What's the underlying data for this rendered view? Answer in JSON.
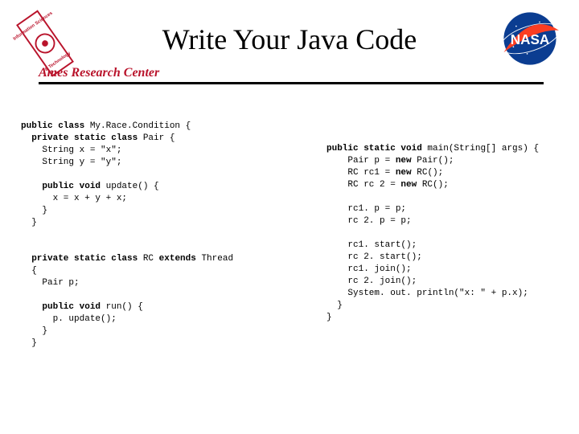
{
  "title": "Write Your Java Code",
  "subhead": "Ames Research Center",
  "badge_text_line1": "Information Sciences",
  "badge_text_line2": "& Technology",
  "logo_name": "NASA",
  "code_left_tokens": [
    {
      "t": "public class",
      "k": 1
    },
    {
      "t": " My.Race.Condition {\n"
    },
    {
      "t": "  private static class",
      "k": 1
    },
    {
      "t": " Pair {\n"
    },
    {
      "t": "    String x = \"x\";\n"
    },
    {
      "t": "    String y = \"y\";\n\n"
    },
    {
      "t": "    public void",
      "k": 1
    },
    {
      "t": " update() {\n"
    },
    {
      "t": "      x = x + y + x;\n"
    },
    {
      "t": "    }\n"
    },
    {
      "t": "  }\n\n\n"
    },
    {
      "t": "  private static class",
      "k": 1
    },
    {
      "t": " RC "
    },
    {
      "t": "extends",
      "k": 1
    },
    {
      "t": " Thread\n"
    },
    {
      "t": "  {\n"
    },
    {
      "t": "    Pair p;\n\n"
    },
    {
      "t": "    public void",
      "k": 1
    },
    {
      "t": " run() {\n"
    },
    {
      "t": "      p. update();\n"
    },
    {
      "t": "    }\n"
    },
    {
      "t": "  }\n"
    }
  ],
  "code_right_tokens": [
    {
      "t": "public static void",
      "k": 1
    },
    {
      "t": " main(String[] args) {\n"
    },
    {
      "t": "    Pair p = "
    },
    {
      "t": "new",
      "k": 1
    },
    {
      "t": " Pair();\n"
    },
    {
      "t": "    RC rc1 = "
    },
    {
      "t": "new",
      "k": 1
    },
    {
      "t": " RC();\n"
    },
    {
      "t": "    RC rc 2 = "
    },
    {
      "t": "new",
      "k": 1
    },
    {
      "t": " RC();\n\n"
    },
    {
      "t": "    rc1. p = p;\n"
    },
    {
      "t": "    rc 2. p = p;\n\n"
    },
    {
      "t": "    rc1. start();\n"
    },
    {
      "t": "    rc 2. start();\n"
    },
    {
      "t": "    rc1. join();\n"
    },
    {
      "t": "    rc 2. join();\n"
    },
    {
      "t": "    System. out. println(\"x: \" + p.x);\n"
    },
    {
      "t": "  }\n"
    },
    {
      "t": "}\n"
    }
  ]
}
